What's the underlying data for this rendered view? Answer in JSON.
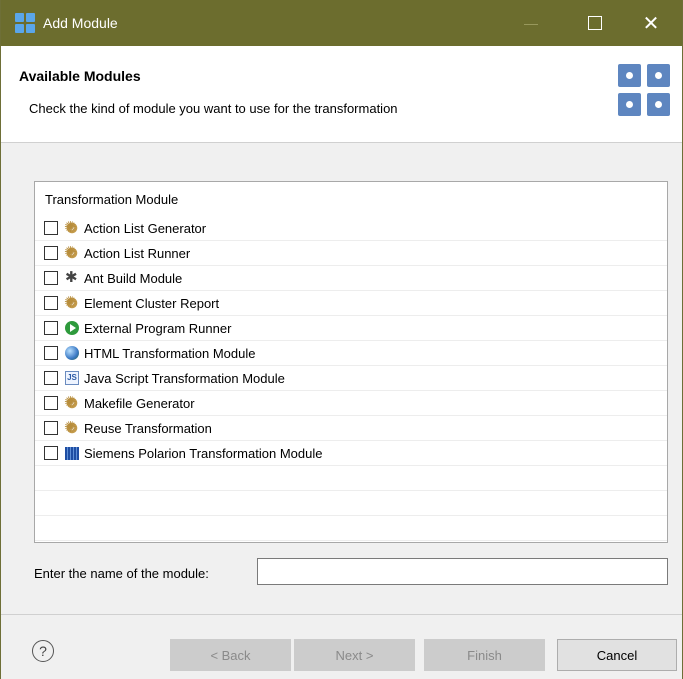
{
  "window": {
    "title": "Add Module"
  },
  "header": {
    "title": "Available Modules",
    "description": "Check the kind of module you want to use for the transformation"
  },
  "list": {
    "column_header": "Transformation Module",
    "items": [
      {
        "label": "Action List Generator",
        "icon": "gear-icon",
        "checked": false
      },
      {
        "label": "Action List Runner",
        "icon": "gear-icon",
        "checked": false
      },
      {
        "label": "Ant Build Module",
        "icon": "bug-icon",
        "checked": false
      },
      {
        "label": "Element Cluster Report",
        "icon": "gear-icon",
        "checked": false
      },
      {
        "label": "External Program Runner",
        "icon": "play-icon",
        "checked": false
      },
      {
        "label": "HTML Transformation Module",
        "icon": "globe-icon",
        "checked": false
      },
      {
        "label": "Java Script Transformation Module",
        "icon": "javascript-file-icon",
        "checked": false
      },
      {
        "label": "Makefile Generator",
        "icon": "gear-icon",
        "checked": false
      },
      {
        "label": "Reuse Transformation",
        "icon": "gear-icon",
        "checked": false
      },
      {
        "label": "Siemens Polarion Transformation Module",
        "icon": "polarion-icon",
        "checked": false
      }
    ]
  },
  "name_field": {
    "label": "Enter the name of the module:",
    "value": ""
  },
  "buttons": {
    "back": "< Back",
    "next": "Next >",
    "finish": "Finish",
    "cancel": "Cancel"
  },
  "colors": {
    "titlebar": "#6c6d2e",
    "accent_icon": "#5e86c0"
  }
}
